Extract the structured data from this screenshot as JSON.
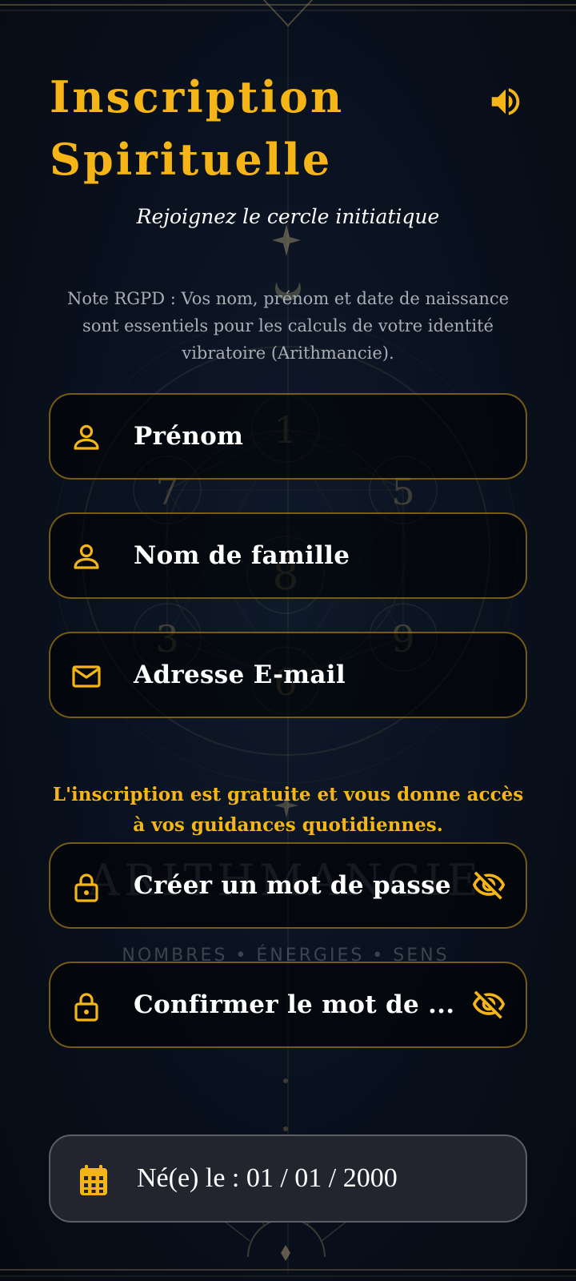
{
  "header": {
    "title_line1": "Inscription",
    "title_line2": "Spirituelle",
    "sound_icon": "volume-up-icon",
    "subtitle": "Rejoignez le cercle initiatique"
  },
  "rgpd_note": "Note RGPD : Vos nom, prénom et date de naissance sont essentiels pour les calculs de votre identité vibratoire (Arithmancie).",
  "fields": {
    "first_name": {
      "placeholder": "Prénom",
      "icon": "person-icon"
    },
    "last_name": {
      "placeholder": "Nom de famille",
      "icon": "person-icon"
    },
    "email": {
      "placeholder": "Adresse E-mail",
      "icon": "envelope-icon"
    },
    "password": {
      "placeholder": "Créer un mot de passe",
      "icon": "lock-icon",
      "toggle_icon": "eye-off-icon"
    },
    "confirm_password": {
      "placeholder": "Confirmer le mot de ...",
      "icon": "lock-icon",
      "toggle_icon": "eye-off-icon"
    }
  },
  "info_message": "L'inscription est gratuite et vous donne accès à vos guidances quotidiennes.",
  "birth_date": {
    "label": "Né(e) le : 01 / 01 / 2000",
    "icon": "calendar-icon"
  },
  "background": {
    "numbers": [
      "1",
      "7",
      "5",
      "8",
      "3",
      "9",
      "6"
    ],
    "brand": "ARITHMANCIE",
    "tagline": "NOMBRES • ÉNERGIES • SENS"
  },
  "colors": {
    "accent": "#f5b517",
    "background": "#0a1220",
    "field_border": "#d4a017",
    "muted_text": "#a9adb4"
  }
}
